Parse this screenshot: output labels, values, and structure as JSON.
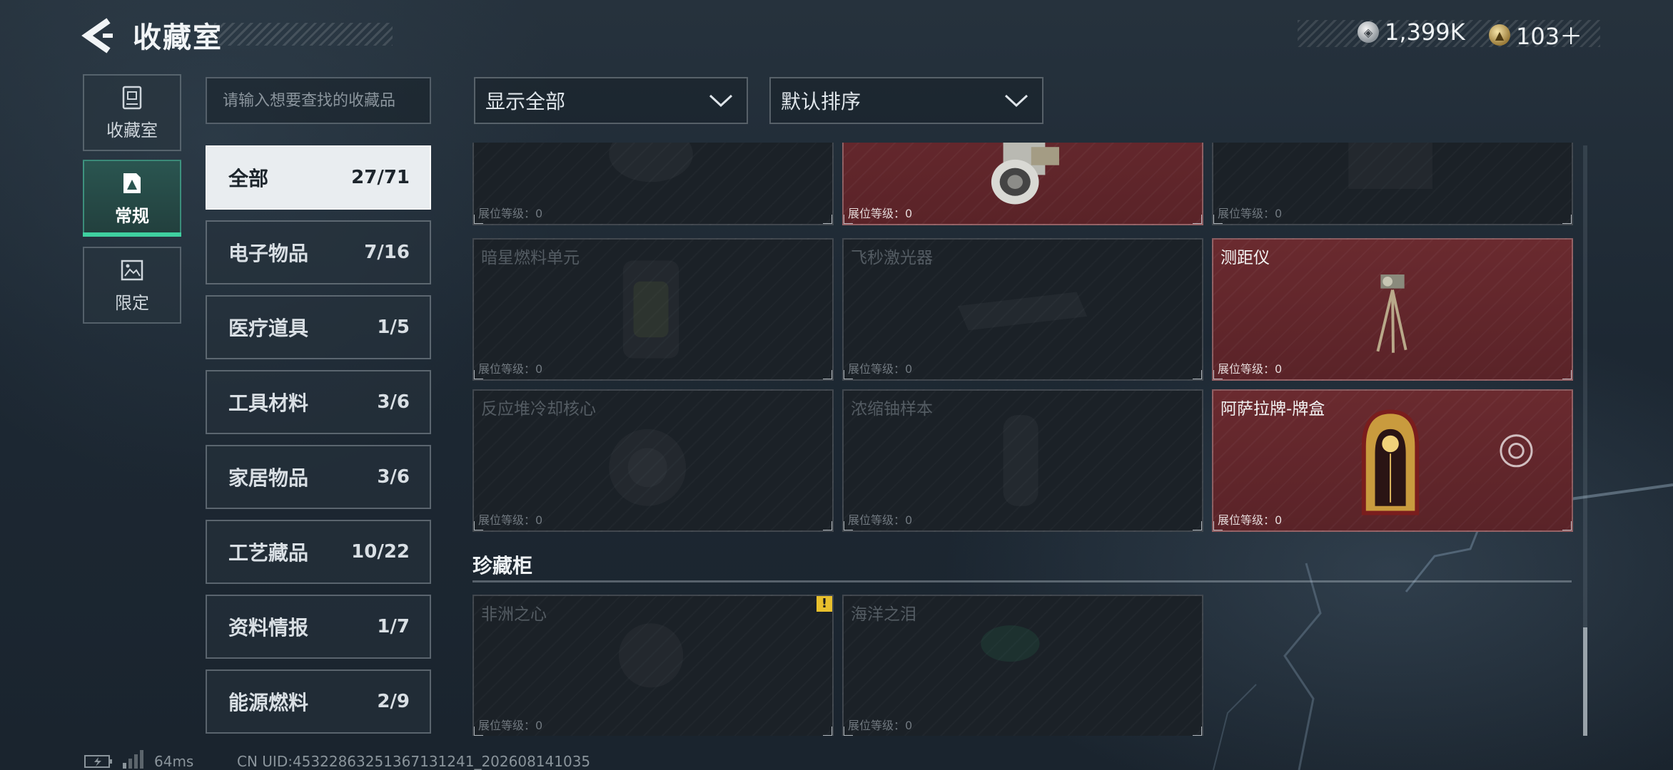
{
  "header": {
    "title": "收藏室",
    "back_icon": "back-chevron-icon",
    "currencies": [
      {
        "icon": "silver-coin-icon",
        "value": "1,399K"
      },
      {
        "icon": "gold-coin-icon",
        "value": "103＋"
      }
    ]
  },
  "nav": {
    "items": [
      {
        "label": "收藏室",
        "icon": "collection-room-icon",
        "active": false
      },
      {
        "label": "常规",
        "icon": "regular-icon",
        "active": true
      },
      {
        "label": "限定",
        "icon": "limited-icon",
        "active": false
      }
    ]
  },
  "search": {
    "placeholder": "请输入想要查找的收藏品"
  },
  "categories": [
    {
      "name": "全部",
      "count": "27/71",
      "active": true
    },
    {
      "name": "电子物品",
      "count": "7/16"
    },
    {
      "name": "医疗道具",
      "count": "1/5"
    },
    {
      "name": "工具材料",
      "count": "3/6"
    },
    {
      "name": "家居物品",
      "count": "3/6"
    },
    {
      "name": "工艺藏品",
      "count": "10/22"
    },
    {
      "name": "资料情报",
      "count": "1/7"
    },
    {
      "name": "能源燃料",
      "count": "2/9"
    }
  ],
  "filters": {
    "display": "显示全部",
    "sort": "默认排序"
  },
  "grid": {
    "level_label": "展位等级：0",
    "row0": [
      {
        "name": "",
        "owned": false
      },
      {
        "name": "",
        "owned": true
      },
      {
        "name": "",
        "owned": false
      }
    ],
    "row1": [
      {
        "name": "暗星燃料单元",
        "owned": false
      },
      {
        "name": "飞秒激光器",
        "owned": false
      },
      {
        "name": "测距仪",
        "owned": true
      }
    ],
    "row2": [
      {
        "name": "反应堆冷却核心",
        "owned": false
      },
      {
        "name": "浓缩铀样本",
        "owned": false
      },
      {
        "name": "阿萨拉牌-牌盒",
        "owned": true
      }
    ]
  },
  "cabinet": {
    "title": "珍藏柜",
    "items": [
      {
        "name": "非洲之心",
        "owned": false,
        "warning": "!"
      },
      {
        "name": "海洋之泪",
        "owned": false
      }
    ]
  },
  "status_bar": {
    "ping": "64ms",
    "uid": "CN UID:4532286325136713124​1_202608141035"
  },
  "colors": {
    "accent": "#3fd0a0",
    "owned_card": "#5e2529",
    "warning": "#e8c02d"
  }
}
